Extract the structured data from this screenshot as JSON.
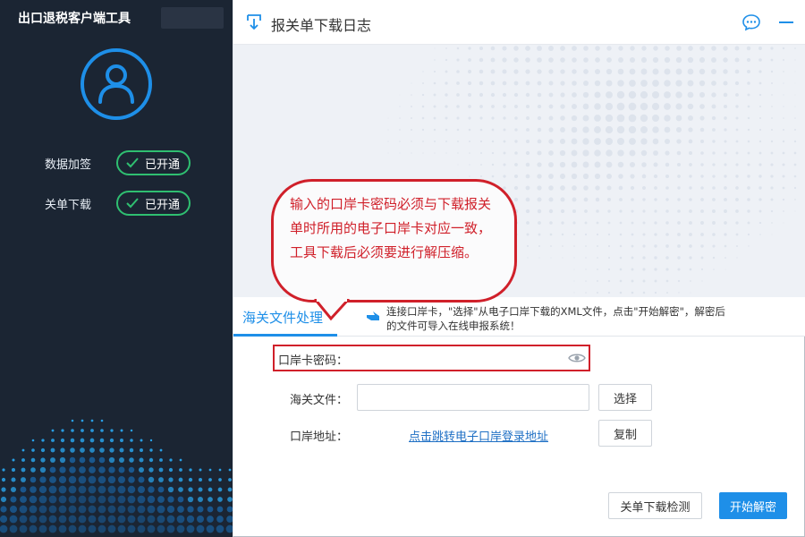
{
  "sidebar": {
    "app_title": "出口退税客户端工具",
    "status_items": [
      {
        "label": "数据加签",
        "status": "已开通"
      },
      {
        "label": "关单下载",
        "status": "已开通"
      }
    ]
  },
  "window": {
    "title": "报关单下载日志"
  },
  "callout": {
    "text": "输入的口岸卡密码必须与下载报关单时所用的电子口岸卡对应一致，工具下载后必须要进行解压缩。"
  },
  "tab": {
    "label": "海关文件处理"
  },
  "hint": {
    "text": "连接口岸卡，\"选择\"从电子口岸下载的XML文件，点击\"开始解密\"，解密后的文件可导入在线申报系统！"
  },
  "form": {
    "password_label": "口岸卡密码：",
    "password_value": "",
    "file_label": "海关文件：",
    "file_value": "",
    "select_button": "选择",
    "address_label": "口岸地址：",
    "address_link": "点击跳转电子口岸登录地址",
    "copy_button": "复制"
  },
  "footer": {
    "check_button": "关单下载检测",
    "start_button": "开始解密"
  },
  "colors": {
    "accent": "#1e8fe8",
    "success": "#2fbf71",
    "annotation_red": "#d0202a",
    "sidebar_bg": "#1b2533"
  }
}
